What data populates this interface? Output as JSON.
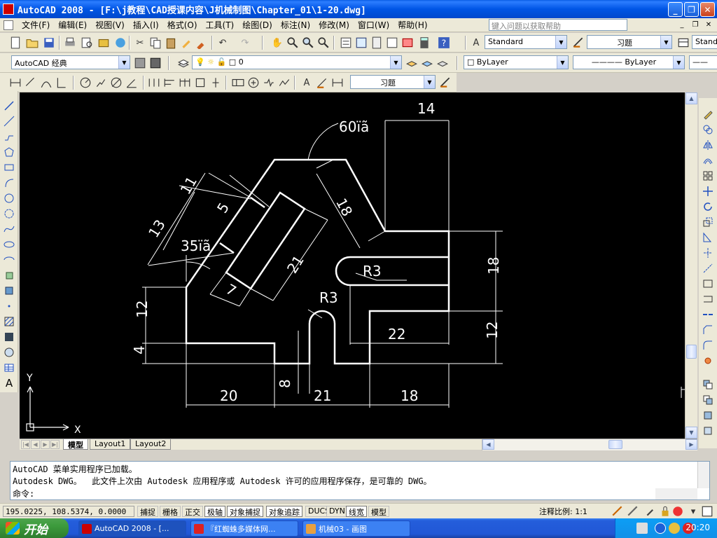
{
  "window": {
    "title": "AutoCAD 2008 - [F:\\j教程\\CAD授课内容\\J机械制图\\Chapter_01\\1-20.dwg]"
  },
  "menu": {
    "items": [
      "文件(F)",
      "编辑(E)",
      "视图(V)",
      "插入(I)",
      "格式(O)",
      "工具(T)",
      "绘图(D)",
      "标注(N)",
      "修改(M)",
      "窗口(W)",
      "帮助(H)"
    ],
    "help_placeholder": "键入问题以获取帮助"
  },
  "toolbars": {
    "text_style": "Standard",
    "dim_style": "习题",
    "table_style": "Stand",
    "workspace": "AutoCAD 经典",
    "layer": "0",
    "color": "ByLayer",
    "linetype": "ByLayer",
    "dim_style_2": "习题"
  },
  "drawing": {
    "dims": {
      "d14": "14",
      "d60": "60ïã",
      "d11": "11",
      "d5": "5",
      "d18a": "18",
      "d13": "13",
      "d35": "35ïã",
      "d21a": "21",
      "d7": "7",
      "r3a": "R3",
      "r3b": "R3",
      "d18b": "18",
      "d12a": "12",
      "d4": "4",
      "d22": "22",
      "d12b": "12",
      "d20": "20",
      "d8": "8",
      "d21b": "21",
      "d18c": "18"
    },
    "ucs_x": "X",
    "ucs_y": "Y",
    "colors": {
      "background": "#000000",
      "lines": "#ffffff"
    }
  },
  "tabs": [
    "模型",
    "Layout1",
    "Layout2"
  ],
  "command": {
    "line1": "AutoCAD 菜单实用程序已加载。",
    "line2": "Autodesk DWG。  此文件上次由 Autodesk 应用程序或 Autodesk 许可的应用程序保存，是可靠的 DWG。",
    "prompt": "命令:"
  },
  "status": {
    "coords": "195.0225, 108.5374, 0.0000",
    "buttons": [
      "捕捉",
      "栅格",
      "正交",
      "极轴",
      "对象捕捉",
      "对象追踪",
      "DUCS",
      "DYN",
      "线宽",
      "模型"
    ],
    "scale_label": "注释比例: 1:1"
  },
  "taskbar": {
    "start_label": "开始",
    "items": [
      "AutoCAD 2008 - [...",
      "『红蜘蛛多媒体网...",
      "机械03 - 画图"
    ],
    "clock": "20:20"
  }
}
